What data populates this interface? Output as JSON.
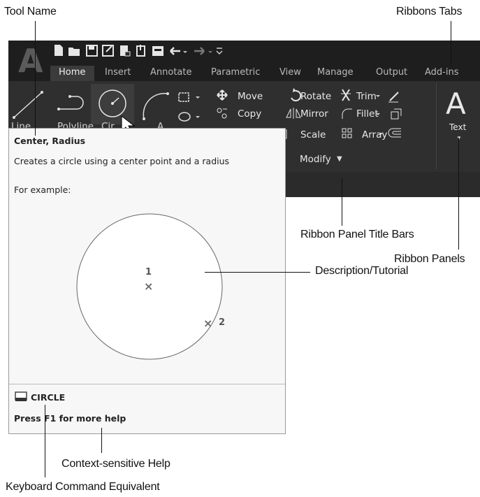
{
  "callouts": {
    "tool_name": "Tool Name",
    "ribbons_tabs": "Ribbons Tabs",
    "ribbon_panel_title_bars": "Ribbon Panel Title Bars",
    "ribbon_panels": "Ribbon Panels",
    "description_tutorial": "Description/Tutorial",
    "context_sensitive_help": "Context-sensitive Help",
    "keyboard_command_equivalent": "Keyboard Command Equivalent"
  },
  "app": {
    "logo": "A",
    "tabs": [
      "Home",
      "Insert",
      "Annotate",
      "Parametric",
      "View",
      "Manage",
      "Output",
      "Add-ins"
    ],
    "modify_tools": {
      "move": "Move",
      "copy": "Copy",
      "rotate": "Rotate",
      "mirror": "Mirror",
      "scale": "Scale",
      "trim": "Trim",
      "fillet": "Fillet",
      "array": "Array"
    },
    "modify_panel_title": "Modify",
    "text_tool": "Text",
    "draw_partial_labels": {
      "line": "Line",
      "polyline": "Polyline",
      "circle": "Cir",
      "arc": "A"
    }
  },
  "tooltip": {
    "title": "Center, Radius",
    "description": "Creates a circle using a center point and a radius",
    "example_label": "For example:",
    "point1": "1",
    "point2": "2",
    "command": "CIRCLE",
    "help": "Press F1 for more help"
  }
}
